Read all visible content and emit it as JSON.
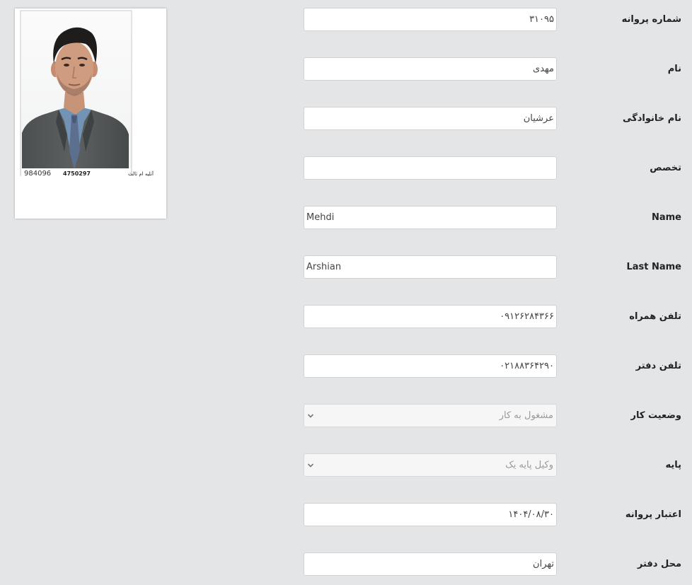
{
  "form": {
    "fields": [
      {
        "label": "شماره پروانه",
        "value": "۳۱۰۹۵",
        "dir": "rtl"
      },
      {
        "label": "نام",
        "value": "مهدی",
        "dir": "rtl"
      },
      {
        "label": "نام خانوادگی",
        "value": "عرشیان",
        "dir": "rtl"
      },
      {
        "label": "تخصص",
        "value": "",
        "dir": "rtl"
      },
      {
        "label": "Name",
        "value": "Mehdi",
        "dir": "ltr"
      },
      {
        "label": "Last Name",
        "value": "Arshian",
        "dir": "ltr"
      },
      {
        "label": "تلفن همراه",
        "value": "۰۹۱۲۶۲۸۴۳۶۶",
        "dir": "rtl"
      },
      {
        "label": "تلفن دفتر",
        "value": "۰۲۱۸۸۳۶۴۲۹۰",
        "dir": "rtl"
      },
      {
        "label": "وضعیت کار",
        "value": "مشغول به کار",
        "type": "select"
      },
      {
        "label": "پایه",
        "value": "وکیل پایه یک",
        "type": "select"
      },
      {
        "label": "اعتبار پروانه",
        "value": "۱۴۰۴/۰۸/۳۰",
        "dir": "rtl"
      },
      {
        "label": "محل دفتر",
        "value": "تهران",
        "dir": "rtl"
      }
    ]
  },
  "photo": {
    "stamp_number": "984096",
    "stamp_code": "4750297",
    "stamp_text": "آتلیه ام ثالث"
  },
  "colors": {
    "page_background": "#e4e5e7",
    "field_border": "#cfd2d6",
    "select_background": "#f6f6f6",
    "label_text": "#222222"
  }
}
